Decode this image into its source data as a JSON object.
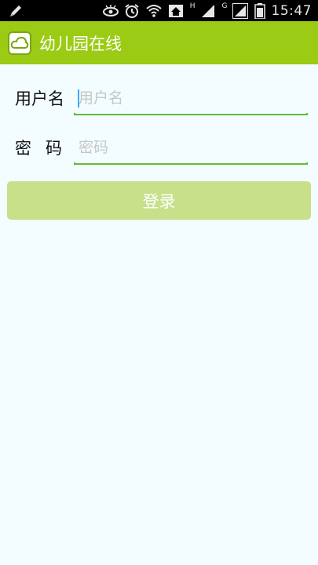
{
  "status_bar": {
    "time": "15:47",
    "network_type_1": "H",
    "network_type_2": "G",
    "icons": [
      "edit-icon",
      "eye-icon",
      "alarm-icon",
      "wifi-icon",
      "home-icon",
      "signal-icon",
      "signal-icon-2",
      "battery-icon"
    ]
  },
  "action_bar": {
    "title": "幼儿园在线",
    "icon": "cloud-icon"
  },
  "form": {
    "username_label": "用户名",
    "username_placeholder": "用户名",
    "password_label": "密码",
    "password_placeholder": "密码"
  },
  "login_button": {
    "label": "登录"
  },
  "colors": {
    "action_bar": "#9bcb14",
    "underline": "#5fbb3a",
    "button": "#c8e08a",
    "background": "#f3fcff"
  }
}
